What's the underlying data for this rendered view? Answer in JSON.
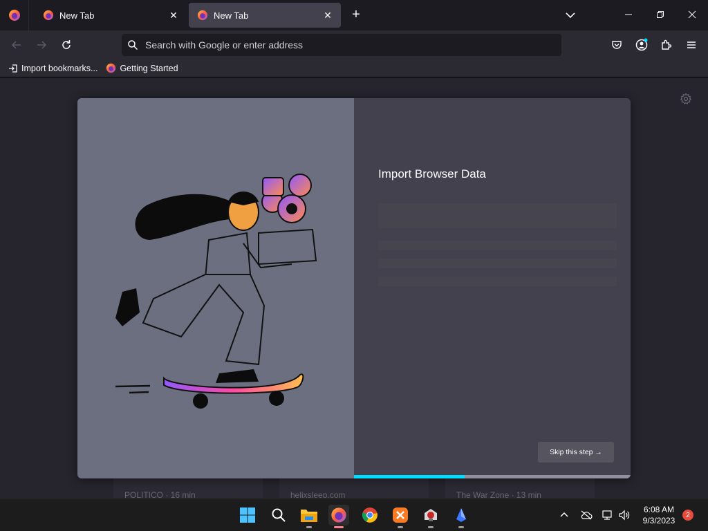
{
  "browser": {
    "tabs": [
      {
        "title": "New Tab",
        "active": false
      },
      {
        "title": "New Tab",
        "active": true
      }
    ],
    "close_glyph": "✕",
    "new_tab_glyph": "+"
  },
  "navbar": {
    "url_placeholder": "Search with Google or enter address"
  },
  "bookmarks": [
    {
      "label": "Import bookmarks...",
      "icon": "import-icon"
    },
    {
      "label": "Getting Started",
      "icon": "firefox-icon"
    }
  ],
  "background_stories": [
    {
      "source": "POLITICO · 16 min"
    },
    {
      "source": "helixsleep.com"
    },
    {
      "source": "The War Zone · 13 min"
    }
  ],
  "modal": {
    "title": "Import Browser Data",
    "skip_label": "Skip this step →",
    "progress": 0.4
  },
  "taskbar": {
    "apps": [
      "start-icon",
      "search-icon",
      "file-explorer-icon",
      "firefox-icon",
      "chrome-icon",
      "xampp-icon",
      "app-icon",
      "paint-icon"
    ],
    "time": "6:08 AM",
    "date": "9/3/2023",
    "notifications": "2"
  },
  "colors": {
    "accent": "#00ddff",
    "modal_left": "#6c6f80",
    "modal_right": "#42414d"
  }
}
